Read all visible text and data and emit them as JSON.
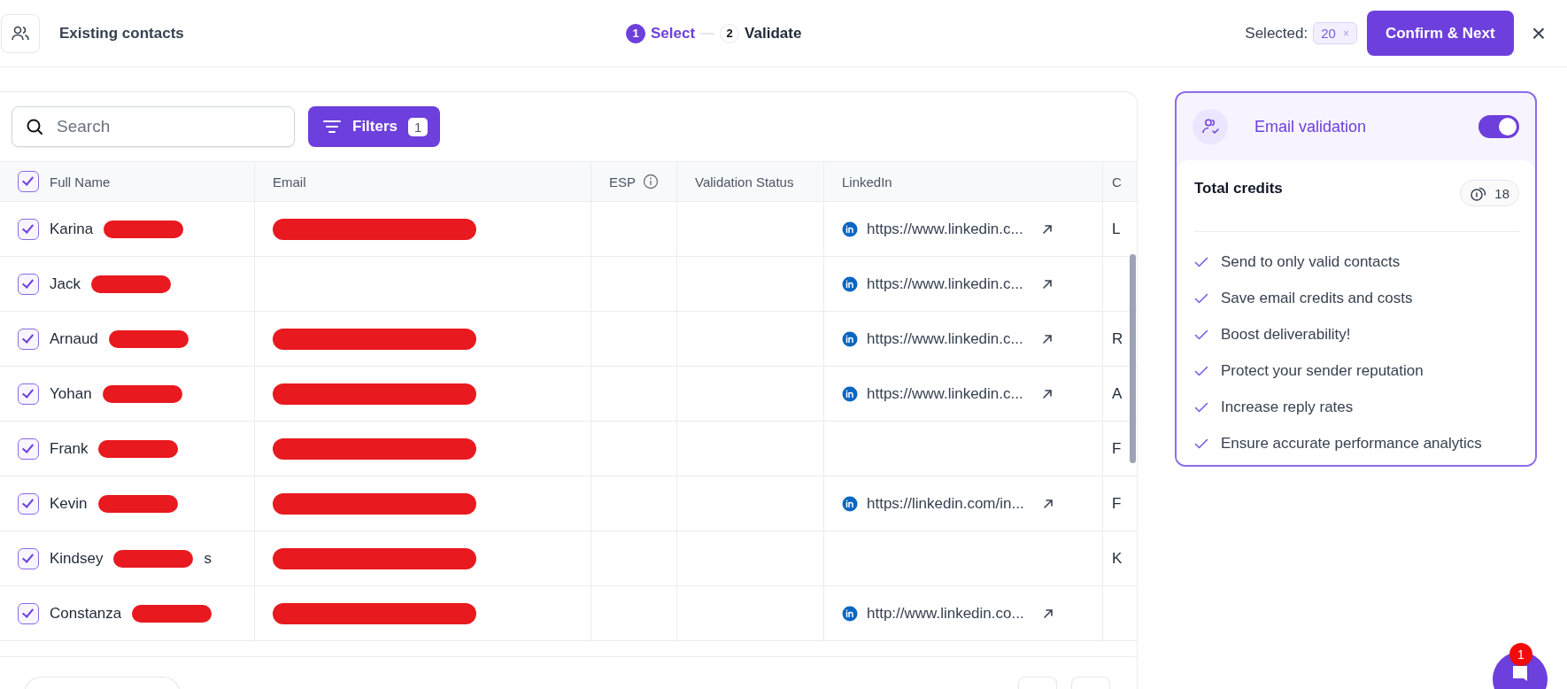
{
  "header": {
    "title": "Existing contacts",
    "steps": [
      {
        "number": "1",
        "label": "Select",
        "selected": true
      },
      {
        "number": "2",
        "label": "Validate",
        "selected": false
      }
    ],
    "selected_label": "Selected:",
    "selected_count": "20",
    "selected_clear": "×",
    "confirm_button": "Confirm & Next",
    "close": "×"
  },
  "toolbar": {
    "search": {
      "placeholder": "Search"
    },
    "filters": {
      "label": "Filters",
      "count": "1"
    }
  },
  "table": {
    "select_all": {
      "checked": true
    },
    "columns": [
      {
        "label": "Full Name"
      },
      {
        "label": "Email"
      },
      {
        "label": "ESP",
        "info_icon": true
      },
      {
        "label": "Validation Status"
      },
      {
        "label": "LinkedIn"
      },
      {
        "label": "C"
      }
    ],
    "rows": [
      {
        "checked": true,
        "name": "Karina",
        "name_redacted": true,
        "email_redacted": true,
        "linkedin": "https://www.linkedin.c...",
        "column_6": "L"
      },
      {
        "checked": true,
        "name": "Jack",
        "name_redacted": true,
        "email_redacted": false,
        "linkedin": "https://www.linkedin.c..."
      },
      {
        "checked": true,
        "name": "Arnaud",
        "name_redacted": true,
        "email_redacted": true,
        "linkedin": "https://www.linkedin.c...",
        "column_6": "R"
      },
      {
        "checked": true,
        "name": "Yohan",
        "name_redacted": true,
        "email_redacted": true,
        "linkedin": "https://www.linkedin.c...",
        "column_6": "A"
      },
      {
        "checked": true,
        "name": "Frank",
        "name_redacted": true,
        "email_redacted": true,
        "column_6": "F"
      },
      {
        "checked": true,
        "name": "Kevin",
        "name_redacted": true,
        "email_redacted": true,
        "linkedin": "https://linkedin.com/in...",
        "column_6": "F"
      },
      {
        "checked": true,
        "name": "Kindsey",
        "name_redacted": true,
        "name_tail": "s",
        "email_redacted": true,
        "column_6": "K"
      },
      {
        "checked": true,
        "name": "Constanza",
        "name_redacted": true,
        "email_redacted": true,
        "linkedin": "http://www.linkedin.co..."
      }
    ]
  },
  "validation_panel": {
    "title": "Email validation",
    "on": true,
    "credits_label": "Total credits",
    "credits": "18",
    "benefits": [
      "Send to only valid contacts",
      "Save email credits and costs",
      "Boost deliverability!",
      "Protect your sender reputation",
      "Increase reply rates",
      "Ensure accurate performance analytics"
    ]
  },
  "chat": {
    "badge": "1"
  }
}
